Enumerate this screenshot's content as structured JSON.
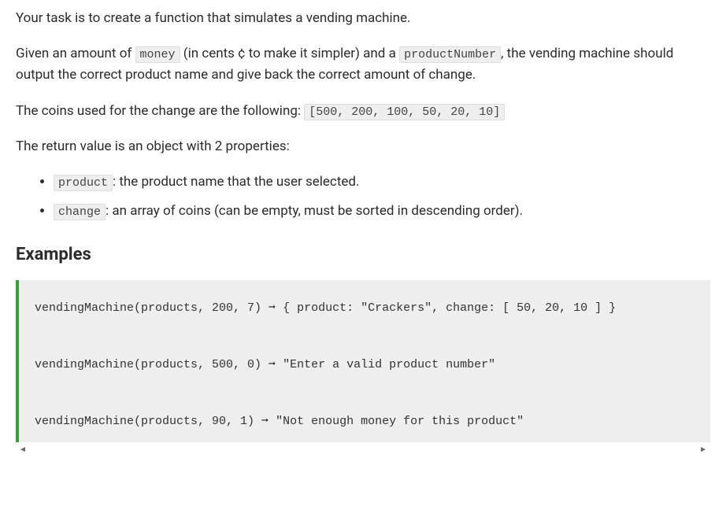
{
  "intro": {
    "p1": "Your task is to create a function that simulates a vending machine.",
    "p2_1": "Given an amount of ",
    "p2_code1": "money",
    "p2_2": " (in cents ¢ to make it simpler) and a ",
    "p2_code2": "productNumber",
    "p2_3": ", the vending machine should output the correct product name and give back the correct amount of change.",
    "p3_1": "The coins used for the change are the following: ",
    "p3_code": "[500, 200, 100, 50, 20, 10]",
    "p4": "The return value is an object with 2 properties:"
  },
  "list": {
    "item1_code": "product",
    "item1_text": ": the product name that the user selected.",
    "item2_code": "change",
    "item2_text": ": an array of coins (can be empty, must be sorted in descending order)."
  },
  "examples_heading": "Examples",
  "code_block": "vendingMachine(products, 200, 7) ➞ { product: \"Crackers\", change: [ 50, 20, 10 ] }\n\nvendingMachine(products, 500, 0) ➞ \"Enter a valid product number\"\n\nvendingMachine(products, 90, 1) ➞ \"Not enough money for this product\""
}
